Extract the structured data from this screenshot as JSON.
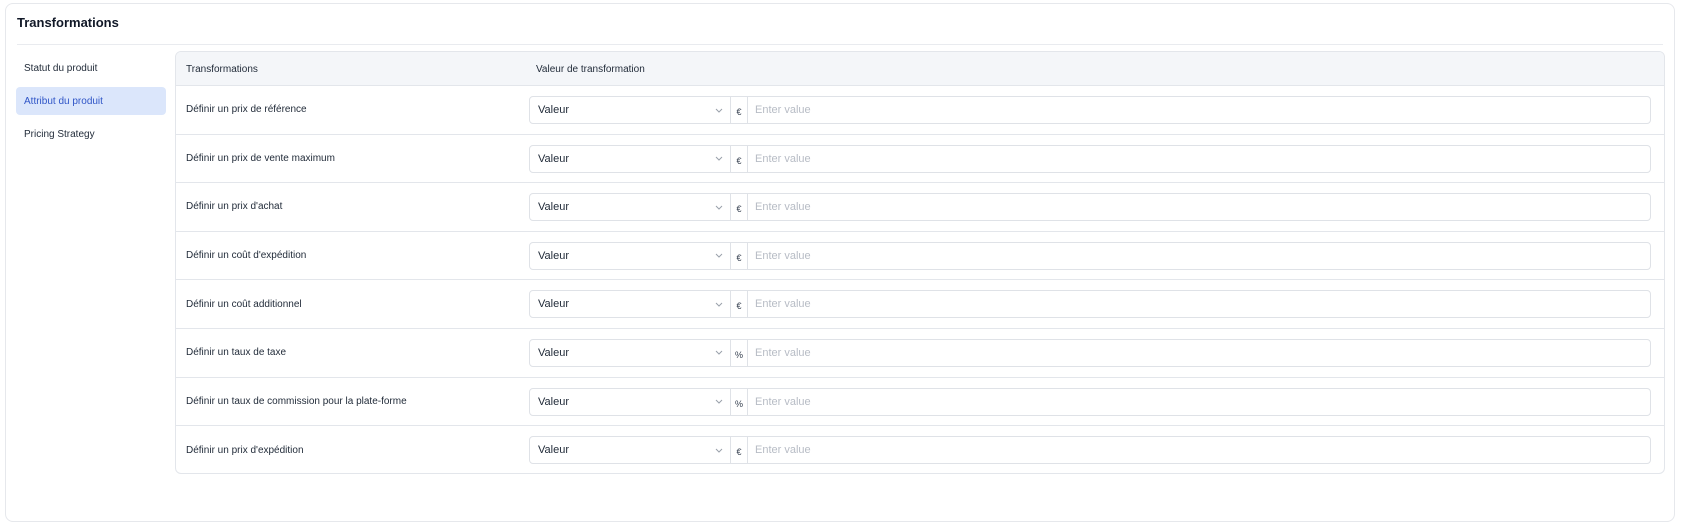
{
  "title": "Transformations",
  "sidebar": {
    "items": [
      {
        "label": "Statut du produit"
      },
      {
        "label": "Attribut du produit"
      },
      {
        "label": "Pricing Strategy"
      }
    ]
  },
  "table": {
    "headers": [
      "Transformations",
      "Valeur de transformation"
    ],
    "rows": [
      {
        "label": "Définir un prix de référence",
        "select": "Valeur",
        "unit": "€",
        "placeholder": "Enter value"
      },
      {
        "label": "Définir un prix de vente maximum",
        "select": "Valeur",
        "unit": "€",
        "placeholder": "Enter value"
      },
      {
        "label": "Définir un prix d'achat",
        "select": "Valeur",
        "unit": "€",
        "placeholder": "Enter value"
      },
      {
        "label": "Définir un coût d'expédition",
        "select": "Valeur",
        "unit": "€",
        "placeholder": "Enter value"
      },
      {
        "label": "Définir un coût additionnel",
        "select": "Valeur",
        "unit": "€",
        "placeholder": "Enter value"
      },
      {
        "label": "Définir un taux de taxe",
        "select": "Valeur",
        "unit": "%",
        "placeholder": "Enter value"
      },
      {
        "label": "Définir un taux de commission pour la plate-forme",
        "select": "Valeur",
        "unit": "%",
        "placeholder": "Enter value"
      },
      {
        "label": "Définir un prix d'expédition",
        "select": "Valeur",
        "unit": "€",
        "placeholder": "Enter value"
      }
    ]
  },
  "icons": {
    "select_caret": "chevron-down-icon"
  },
  "colors": {
    "active_bg": "#dbe6fb",
    "active_text": "#2f55c7",
    "border": "#e3e6eb"
  }
}
